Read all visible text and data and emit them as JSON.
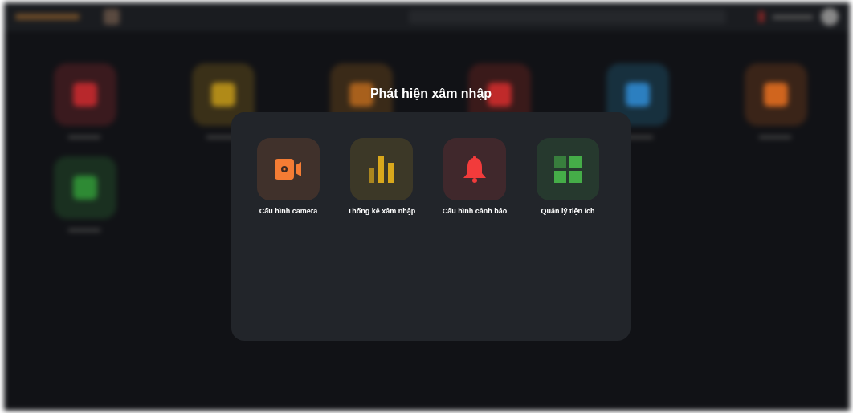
{
  "dialog": {
    "title": "Phát hiện xâm nhập",
    "items": [
      {
        "kind": "camera",
        "label": "Cấu hình camera",
        "color": "#f47c34"
      },
      {
        "kind": "chart",
        "label": "Thống kê xâm nhập",
        "color": "#d9a81c"
      },
      {
        "kind": "bell",
        "label": "Cấu hình cảnh báo",
        "color": "#f23b3b"
      },
      {
        "kind": "grid",
        "label": "Quản lý tiện ích",
        "color": "#45ad48"
      }
    ]
  }
}
